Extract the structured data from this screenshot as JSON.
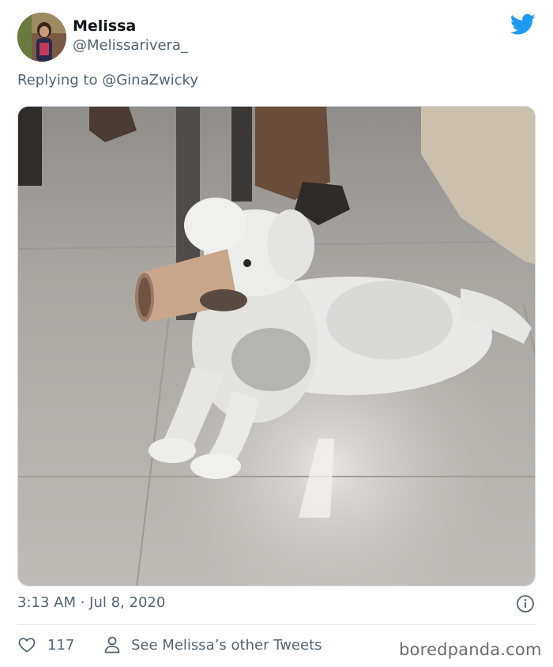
{
  "author": {
    "display_name": "Melissa",
    "handle": "@Melissarivera_"
  },
  "reply": {
    "prefix": "Replying to",
    "mention": "@GinaZwicky"
  },
  "meta": {
    "timestamp": "3:13 AM · Jul 8, 2020"
  },
  "actions": {
    "like_count": "117",
    "see_tweets_label": "See Melissa’s other Tweets"
  },
  "watermark": "boredpanda.com",
  "colors": {
    "twitter_blue": "#1d9bf0",
    "secondary_text": "#536471"
  },
  "icons": [
    "twitter-bird-icon",
    "info-icon",
    "heart-icon",
    "user-icon"
  ]
}
